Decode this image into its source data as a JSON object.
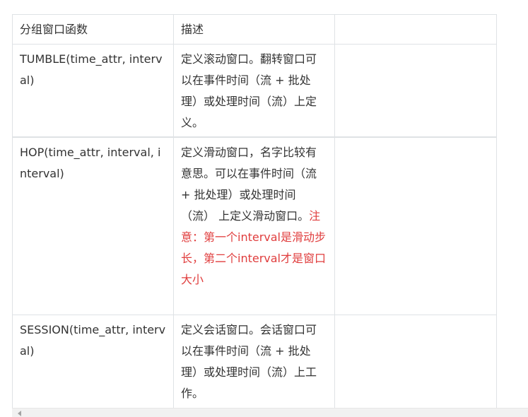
{
  "table": {
    "headers": [
      "分组窗口函数",
      "描述",
      ""
    ],
    "rows": [
      {
        "function": "TUMBLE(time_attr, interval)",
        "description": "定义滚动窗口。翻转窗口可以在事件时间（流 + 批处理）或处理时间（流）上定义。",
        "note": "",
        "extra": ""
      },
      {
        "function": "HOP(time_attr, interval, interval)",
        "description": "定义滑动窗口，名字比较有意思。可以在事件时间（流 + 批处理）或处理时间（流） 上定义滑动窗口。",
        "note": "注意：第一个interval是滑动步长，第二个interval才是窗口大小",
        "extra": ""
      },
      {
        "function": "SESSION(time_attr, interval)",
        "description": "定义会话窗口。会话窗口可以在事件时间（流 + 批处理）或处理时间（流）上工作。",
        "note": "",
        "extra": ""
      }
    ]
  },
  "colors": {
    "note_text": "#e03e3e",
    "border": "#dfe2e5"
  }
}
